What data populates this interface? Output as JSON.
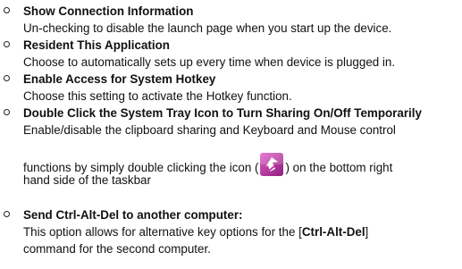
{
  "items": [
    {
      "title": "Show Connection Information",
      "lines": [
        "Un-checking to disable the launch page when you start up the device."
      ]
    },
    {
      "title": "Resident This Application",
      "lines": [
        "Choose to automatically sets up every time when device is plugged in."
      ]
    },
    {
      "title": "Enable Access for System Hotkey",
      "lines": [
        "Choose this setting to activate the Hotkey function."
      ]
    },
    {
      "title": "Double Click the System Tray Icon to Turn Sharing On/Off Temporarily",
      "line1": "Enable/disable the clipboard sharing and Keyboard and Mouse control",
      "line2_before": "functions by simply double clicking the icon (",
      "line2_after": ") on the bottom right",
      "line3": "hand side of the taskbar",
      "icon": "system-tray-sharing-icon",
      "icon_colors": [
        "#c23aa8",
        "#ffffff"
      ]
    },
    {
      "title": "Send Ctrl-Alt-Del to another computer:",
      "line1": "This option allows for alternative key options for the [",
      "line1_bold": "Ctrl-Alt-Del",
      "line1_end": "]",
      "line2": "command for the second computer."
    }
  ]
}
